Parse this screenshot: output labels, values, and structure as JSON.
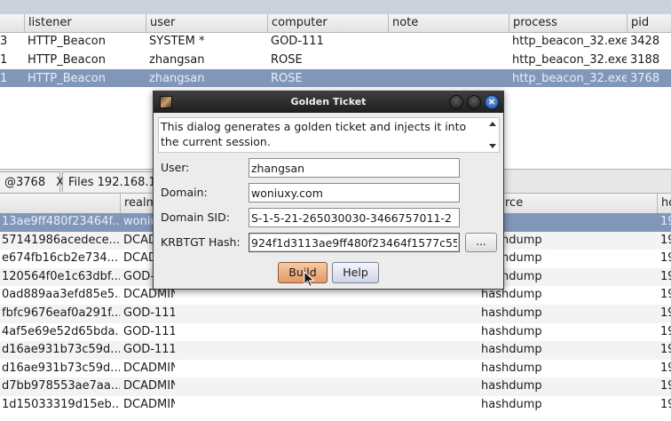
{
  "top_table": {
    "columns": [
      "listener",
      "user",
      "computer",
      "note",
      "process",
      "pid"
    ],
    "rows": [
      {
        "lead": "3",
        "listener": "HTTP_Beacon",
        "user": "SYSTEM *",
        "computer": "GOD-111",
        "note": "",
        "process": "http_beacon_32.exe",
        "pid": "3428"
      },
      {
        "lead": "1",
        "listener": "HTTP_Beacon",
        "user": "zhangsan",
        "computer": "ROSE",
        "note": "",
        "process": "http_beacon_32.exe",
        "pid": "3188"
      },
      {
        "lead": "1",
        "listener": "HTTP_Beacon",
        "user": "zhangsan",
        "computer": "ROSE",
        "note": "",
        "process": "http_beacon_32.exe",
        "pid": "3768",
        "selected": true
      }
    ]
  },
  "tabs": [
    {
      "label": "@3768",
      "close": "X"
    },
    {
      "label": "Files 192.168.1"
    }
  ],
  "bottom_table": {
    "columns": [
      "",
      "realm",
      "",
      "rce",
      "ho"
    ],
    "rows": [
      {
        "hash": "13ae9ff480f23464f...",
        "realm": "woniu",
        "source": "mc",
        "host": "19",
        "selected": true
      },
      {
        "hash": "57141986acedece...",
        "realm": "DCAD",
        "source": "hashdump",
        "host": "19"
      },
      {
        "hash": "e674fb16cb2e734...",
        "realm": "DCAD",
        "source": "hashdump",
        "host": "19"
      },
      {
        "hash": "120564f0e1c63dbf...",
        "realm": "GOD-",
        "source": "hashdump",
        "host": "19"
      },
      {
        "hash": "0ad889aa3efd85e5...",
        "realm": "DCADMIN",
        "source": "hashdump",
        "host": "19"
      },
      {
        "hash": "fbfc9676eaf0a291f...",
        "realm": "GOD-111",
        "source": "hashdump",
        "host": "19"
      },
      {
        "hash": "4af5e69e52d65bda...",
        "realm": "GOD-111",
        "source": "hashdump",
        "host": "19"
      },
      {
        "hash": "d16ae931b73c59d...",
        "realm": "GOD-111",
        "source": "hashdump",
        "host": "19"
      },
      {
        "hash": "d16ae931b73c59d...",
        "realm": "DCADMIN",
        "source": "hashdump",
        "host": "19"
      },
      {
        "hash": "d7bb978553ae7aa...",
        "realm": "DCADMIN",
        "source": "hashdump",
        "host": "19"
      },
      {
        "hash": "1d15033319d15eb...",
        "realm": "DCADMIN",
        "source": "hashdump",
        "host": "19"
      }
    ]
  },
  "dialog": {
    "title": "Golden Ticket",
    "description": "This dialog generates a golden ticket and injects it into the current session.",
    "close_glyph": "×",
    "fields": {
      "user_label": "User:",
      "user_value": "zhangsan",
      "domain_label": "Domain:",
      "domain_value": "woniuxy.com",
      "sid_label": "Domain SID:",
      "sid_value": "S-1-5-21-265030030-3466757011-2",
      "krbtgt_label": "KRBTGT Hash:",
      "krbtgt_value": "924f1d3113ae9ff480f23464f1577c55"
    },
    "ellipsis_label": "...",
    "build_label": "Build",
    "help_label": "Help"
  },
  "icons": [
    "golden-ticket-app-icon",
    "minimize-icon",
    "maximize-icon",
    "close-icon",
    "scroll-up-icon",
    "scroll-down-icon",
    "mouse-pointer-icon"
  ],
  "colors": {
    "selection": "#8197ba",
    "build_button": "#e49a62",
    "close_button": "#1f56b5"
  }
}
